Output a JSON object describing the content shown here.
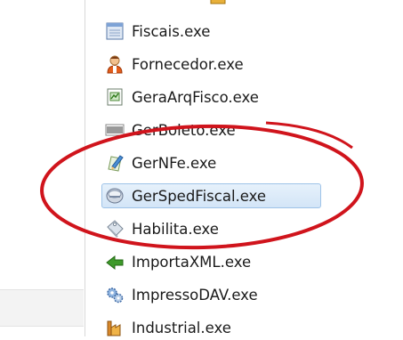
{
  "files": [
    {
      "name": "Fiscais.exe",
      "icon": "window-app-icon"
    },
    {
      "name": "Fornecedor.exe",
      "icon": "person-icon"
    },
    {
      "name": "GeraArqFisco.exe",
      "icon": "document-chart-icon"
    },
    {
      "name": "GerBoleto.exe",
      "icon": "barcode-icon"
    },
    {
      "name": "GerNFe.exe",
      "icon": "pen-document-icon"
    },
    {
      "name": "GerSpedFiscal.exe",
      "icon": "database-disk-icon"
    },
    {
      "name": "Habilita.exe",
      "icon": "tag-icon"
    },
    {
      "name": "ImportaXML.exe",
      "icon": "green-arrow-icon"
    },
    {
      "name": "ImpressoDAV.exe",
      "icon": "gears-icon"
    },
    {
      "name": "Industrial.exe",
      "icon": "factory-icon"
    }
  ],
  "selected": "GerSpedFiscal.exe",
  "annotation_color": "#d0141c"
}
